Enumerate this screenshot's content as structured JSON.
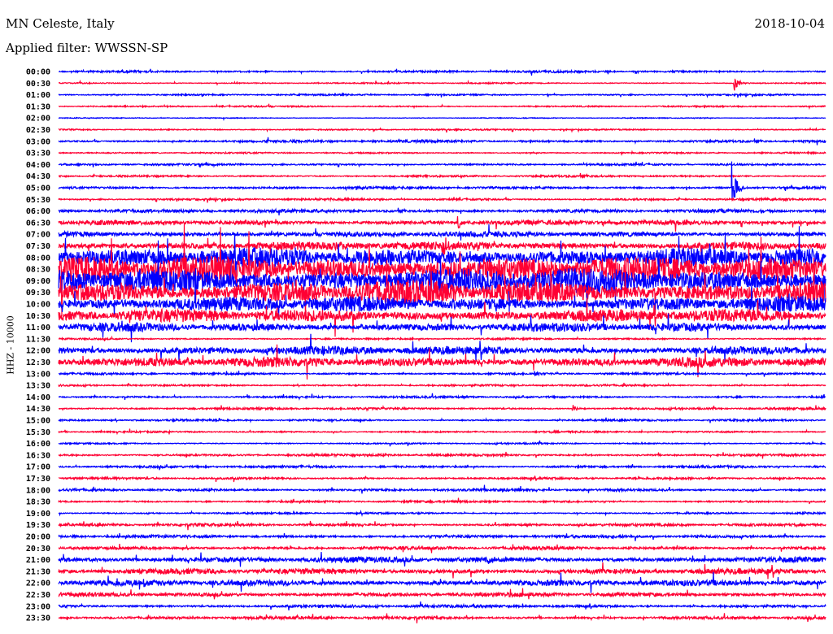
{
  "header": {
    "station": "MN Celeste, Italy",
    "date": "2018-10-04",
    "filter": "Applied filter: WWSSN-SP"
  },
  "chart_data": {
    "type": "line",
    "title": "MN Celeste, Italy",
    "ylabel": "HHZ - 10000",
    "colors": {
      "even": "#0000ff",
      "odd": "#ff0033"
    },
    "rows": [
      {
        "label": "00:00",
        "amp": 1.0
      },
      {
        "label": "00:30",
        "amp": 0.6
      },
      {
        "label": "01:00",
        "amp": 0.8
      },
      {
        "label": "01:30",
        "amp": 0.7
      },
      {
        "label": "02:00",
        "amp": 0.4
      },
      {
        "label": "02:30",
        "amp": 0.7
      },
      {
        "label": "03:00",
        "amp": 1.2
      },
      {
        "label": "03:30",
        "amp": 0.7
      },
      {
        "label": "04:00",
        "amp": 0.9
      },
      {
        "label": "04:30",
        "amp": 0.9
      },
      {
        "label": "05:00",
        "amp": 1.2
      },
      {
        "label": "05:30",
        "amp": 1.0
      },
      {
        "label": "06:00",
        "amp": 1.6
      },
      {
        "label": "06:30",
        "amp": 2.2
      },
      {
        "label": "07:00",
        "amp": 2.5
      },
      {
        "label": "07:30",
        "amp": 4
      },
      {
        "label": "08:00",
        "amp": 9
      },
      {
        "label": "08:30",
        "amp": 12
      },
      {
        "label": "09:00",
        "amp": 12
      },
      {
        "label": "09:30",
        "amp": 11
      },
      {
        "label": "10:00",
        "amp": 7
      },
      {
        "label": "10:30",
        "amp": 6
      },
      {
        "label": "11:00",
        "amp": 4
      },
      {
        "label": "11:30",
        "amp": 0.8
      },
      {
        "label": "12:00",
        "amp": 4
      },
      {
        "label": "12:30",
        "amp": 4.5
      },
      {
        "label": "13:00",
        "amp": 1.0
      },
      {
        "label": "13:30",
        "amp": 0.9
      },
      {
        "label": "14:00",
        "amp": 1.0
      },
      {
        "label": "14:30",
        "amp": 1.0
      },
      {
        "label": "15:00",
        "amp": 0.9
      },
      {
        "label": "15:30",
        "amp": 0.8
      },
      {
        "label": "16:00",
        "amp": 0.7
      },
      {
        "label": "16:30",
        "amp": 1.1
      },
      {
        "label": "17:00",
        "amp": 1.1
      },
      {
        "label": "17:30",
        "amp": 1.0
      },
      {
        "label": "18:00",
        "amp": 1.2
      },
      {
        "label": "18:30",
        "amp": 1.0
      },
      {
        "label": "19:00",
        "amp": 0.8
      },
      {
        "label": "19:30",
        "amp": 1.3
      },
      {
        "label": "20:00",
        "amp": 1.4
      },
      {
        "label": "20:30",
        "amp": 1.5
      },
      {
        "label": "21:00",
        "amp": 2.6
      },
      {
        "label": "21:30",
        "amp": 2.6
      },
      {
        "label": "22:00",
        "amp": 2.8
      },
      {
        "label": "22:30",
        "amp": 2.0
      },
      {
        "label": "23:00",
        "amp": 1.4
      },
      {
        "label": "23:30",
        "amp": 1.4
      }
    ],
    "events": [
      {
        "row": 1,
        "t": 0.88,
        "amp": 12
      },
      {
        "row": 10,
        "t": 0.877,
        "amp": 40
      },
      {
        "row": 14,
        "t": 0.285,
        "amp": 4
      },
      {
        "row": 15,
        "t": 0.5,
        "amp": 14
      },
      {
        "row": 13,
        "t": 0.52,
        "amp": 10
      },
      {
        "row": 42,
        "t": 0.56,
        "amp": 6
      },
      {
        "row": 29,
        "t": 0.67,
        "amp": 5
      },
      {
        "row": 26,
        "t": 0.62,
        "amp": 4
      },
      {
        "row": 44,
        "t": 0.11,
        "amp": 5
      }
    ]
  }
}
